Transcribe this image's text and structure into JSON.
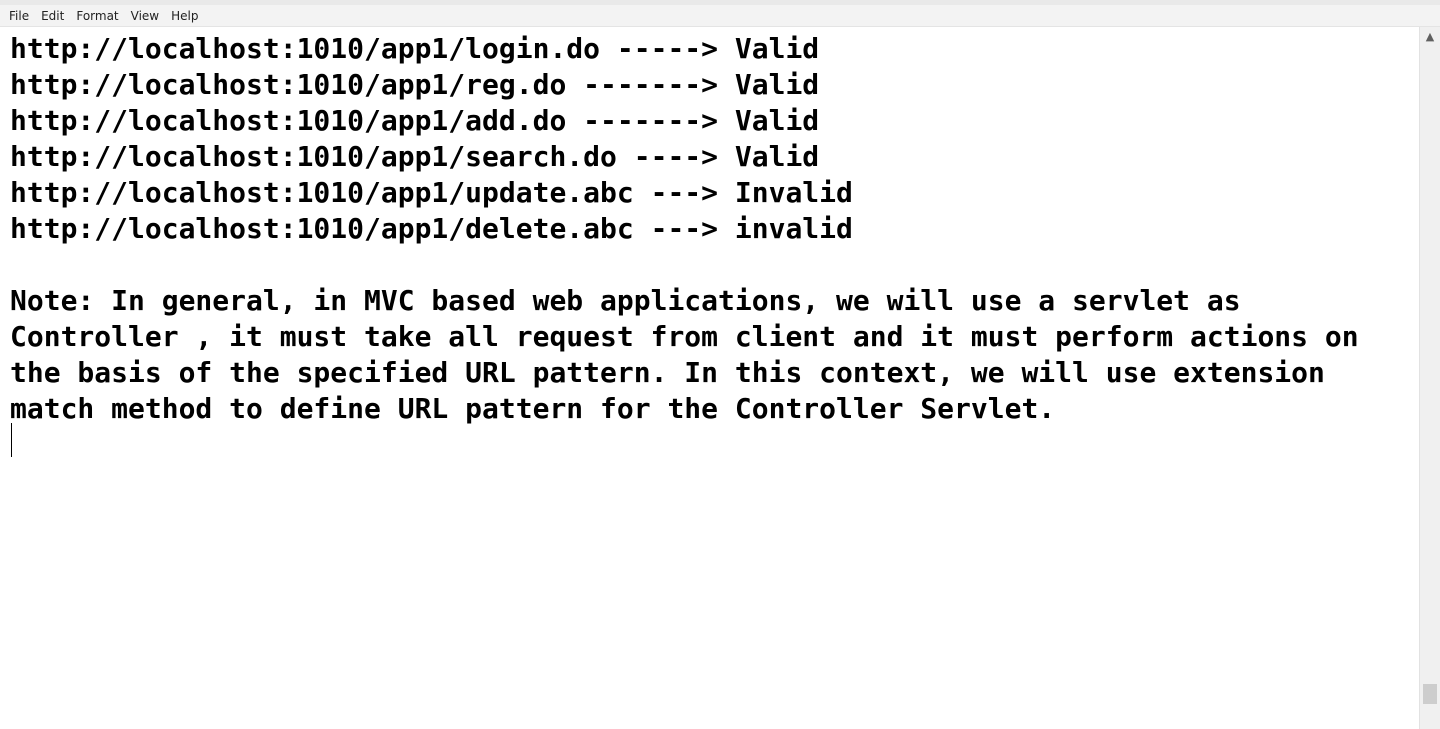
{
  "menu": {
    "file": "File",
    "edit": "Edit",
    "format": "Format",
    "view": "View",
    "help": "Help"
  },
  "editor": {
    "lines": [
      "http://localhost:1010/app1/login.do -----> Valid",
      "http://localhost:1010/app1/reg.do -------> Valid",
      "http://localhost:1010/app1/add.do -------> Valid",
      "http://localhost:1010/app1/search.do ----> Valid",
      "http://localhost:1010/app1/update.abc ---> Invalid",
      "http://localhost:1010/app1/delete.abc ---> invalid"
    ],
    "note_lines": [
      "Note: In general, in MVC based web applications, we will use a servlet as",
      "Controller , it must take all request from client and it must perform actions on",
      "the basis of the specified URL pattern. In this context, we will use extension",
      "match method to define URL pattern for the Controller Servlet."
    ]
  },
  "scrollbar": {
    "up_icon": "chevron-up-icon"
  }
}
